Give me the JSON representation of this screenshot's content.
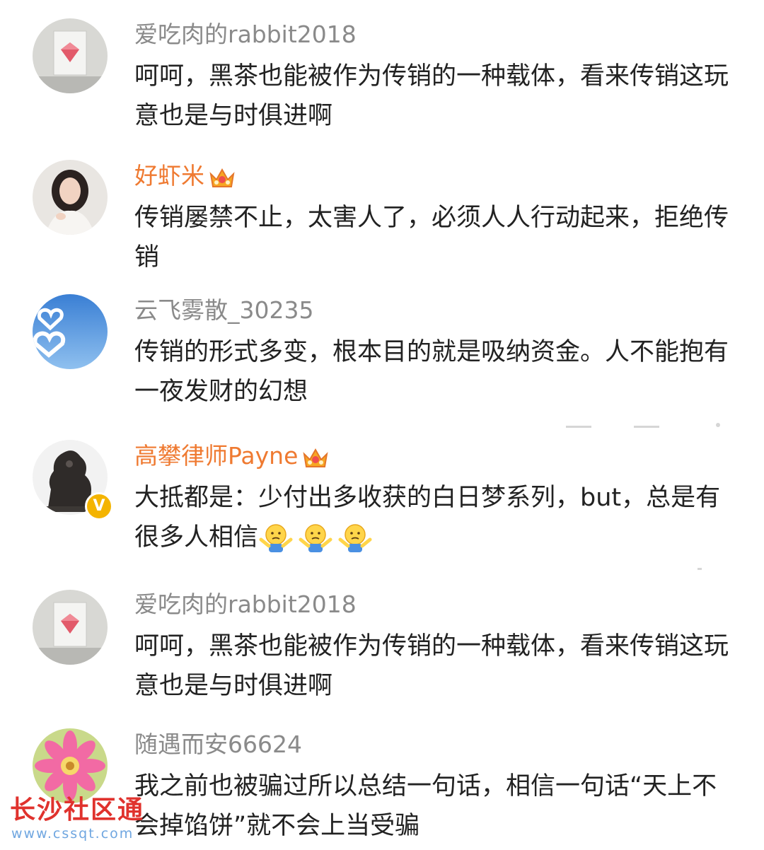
{
  "comments": [
    {
      "username": "爱吃肉的rabbit2018",
      "text": "呵呵，黑茶也能被作为传销的一种载体，看来传销这玩意也是与时俱进啊",
      "avatar": "diamond-picture-avatar",
      "vip": false,
      "verified": false
    },
    {
      "username": "好虾米",
      "text": "传销屡禁不止，太害人了，必须人人行动起来，拒绝传销",
      "avatar": "woman-portrait-avatar",
      "vip": true,
      "verified": false
    },
    {
      "username": "云飞雾散_30235",
      "text": "传销的形式多变，根本目的就是吸纳资金。人不能抱有一夜发财的幻想",
      "avatar": "sky-heart-clouds-avatar",
      "vip": false,
      "verified": false
    },
    {
      "username": "高攀律师Payne",
      "text": "大抵都是：少付出多收获的白日梦系列，but，总是有很多人相信",
      "avatar": "bronze-statue-avatar",
      "vip": true,
      "verified": true,
      "verified_mark": "V"
    },
    {
      "username": "爱吃肉的rabbit2018",
      "text": "呵呵，黑茶也能被作为传销的一种载体，看来传销这玩意也是与时俱进啊",
      "avatar": "diamond-picture-avatar",
      "vip": false,
      "verified": false
    },
    {
      "username": "随遇而安66624",
      "text": "我之前也被骗过所以总结一句话，相信一句话“天上不会掉馅饼”就不会上当受骗",
      "avatar": "pink-flower-avatar",
      "vip": false,
      "verified": false
    }
  ],
  "emojis": [
    "shrug-emoji",
    "shrug-emoji",
    "shrug-emoji"
  ],
  "watermark": {
    "title": "长沙社区通",
    "url": "www.cssqt.com"
  },
  "colors": {
    "username_gray": "#8a8a8a",
    "username_vip_orange": "#ef7a31",
    "body_text": "#222222",
    "watermark_red": "#e0322d",
    "watermark_blue": "#6fa6e0"
  }
}
